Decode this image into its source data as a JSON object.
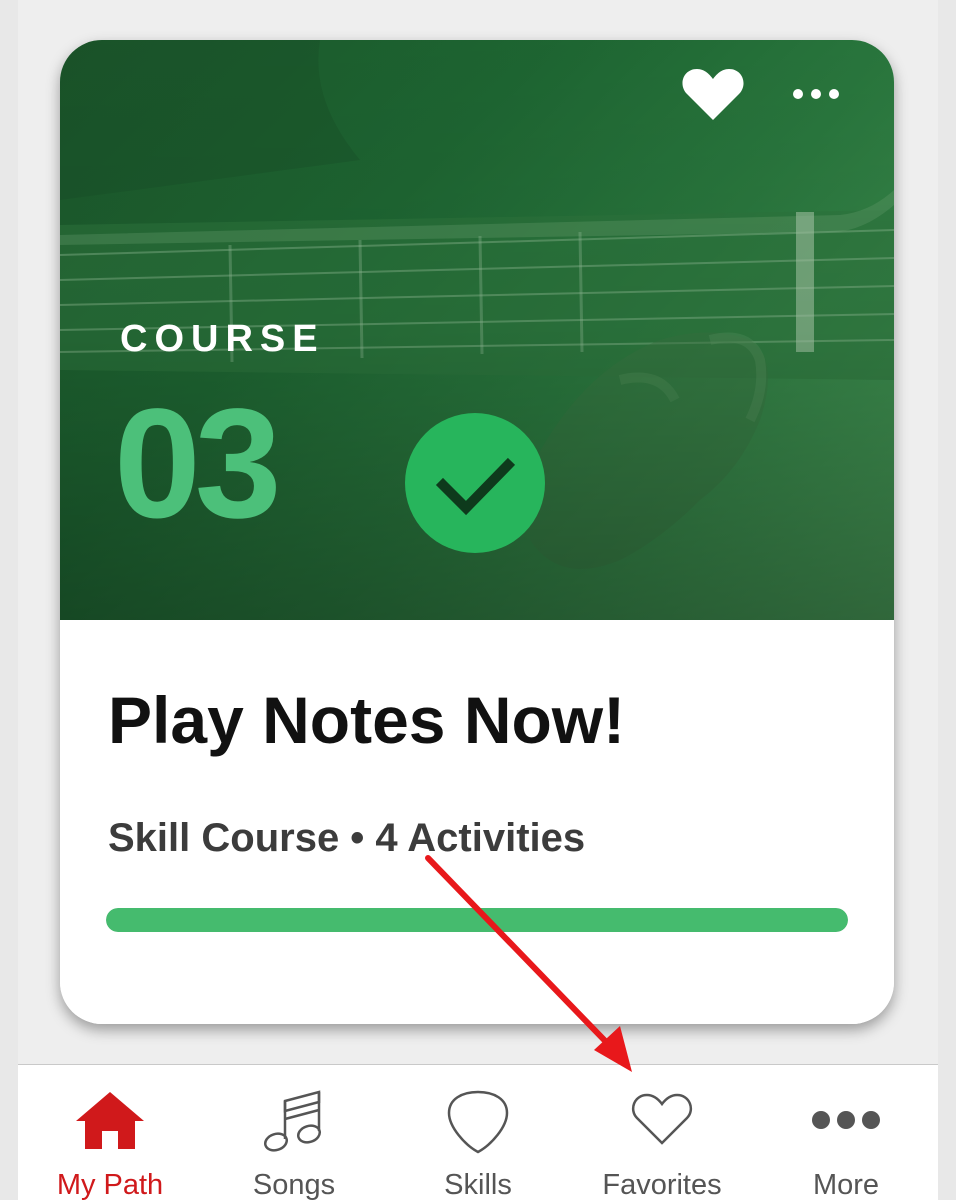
{
  "card": {
    "eyebrow": "COURSE",
    "number": "03",
    "status": "completed",
    "title": "Play Notes Now!",
    "meta": "Skill Course • 4 Activities",
    "progress_percent": 100
  },
  "tabs": [
    {
      "label": "My Path",
      "icon": "home-icon",
      "active": true
    },
    {
      "label": "Songs",
      "icon": "music-note-icon",
      "active": false
    },
    {
      "label": "Skills",
      "icon": "guitar-pick-icon",
      "active": false
    },
    {
      "label": "Favorites",
      "icon": "heart-icon",
      "active": false
    },
    {
      "label": "More",
      "icon": "more-dots-icon",
      "active": false
    }
  ],
  "colors": {
    "accent_green": "#45bb6e",
    "active_tab_red": "#d0191b",
    "annotation_red": "#e8181b"
  }
}
